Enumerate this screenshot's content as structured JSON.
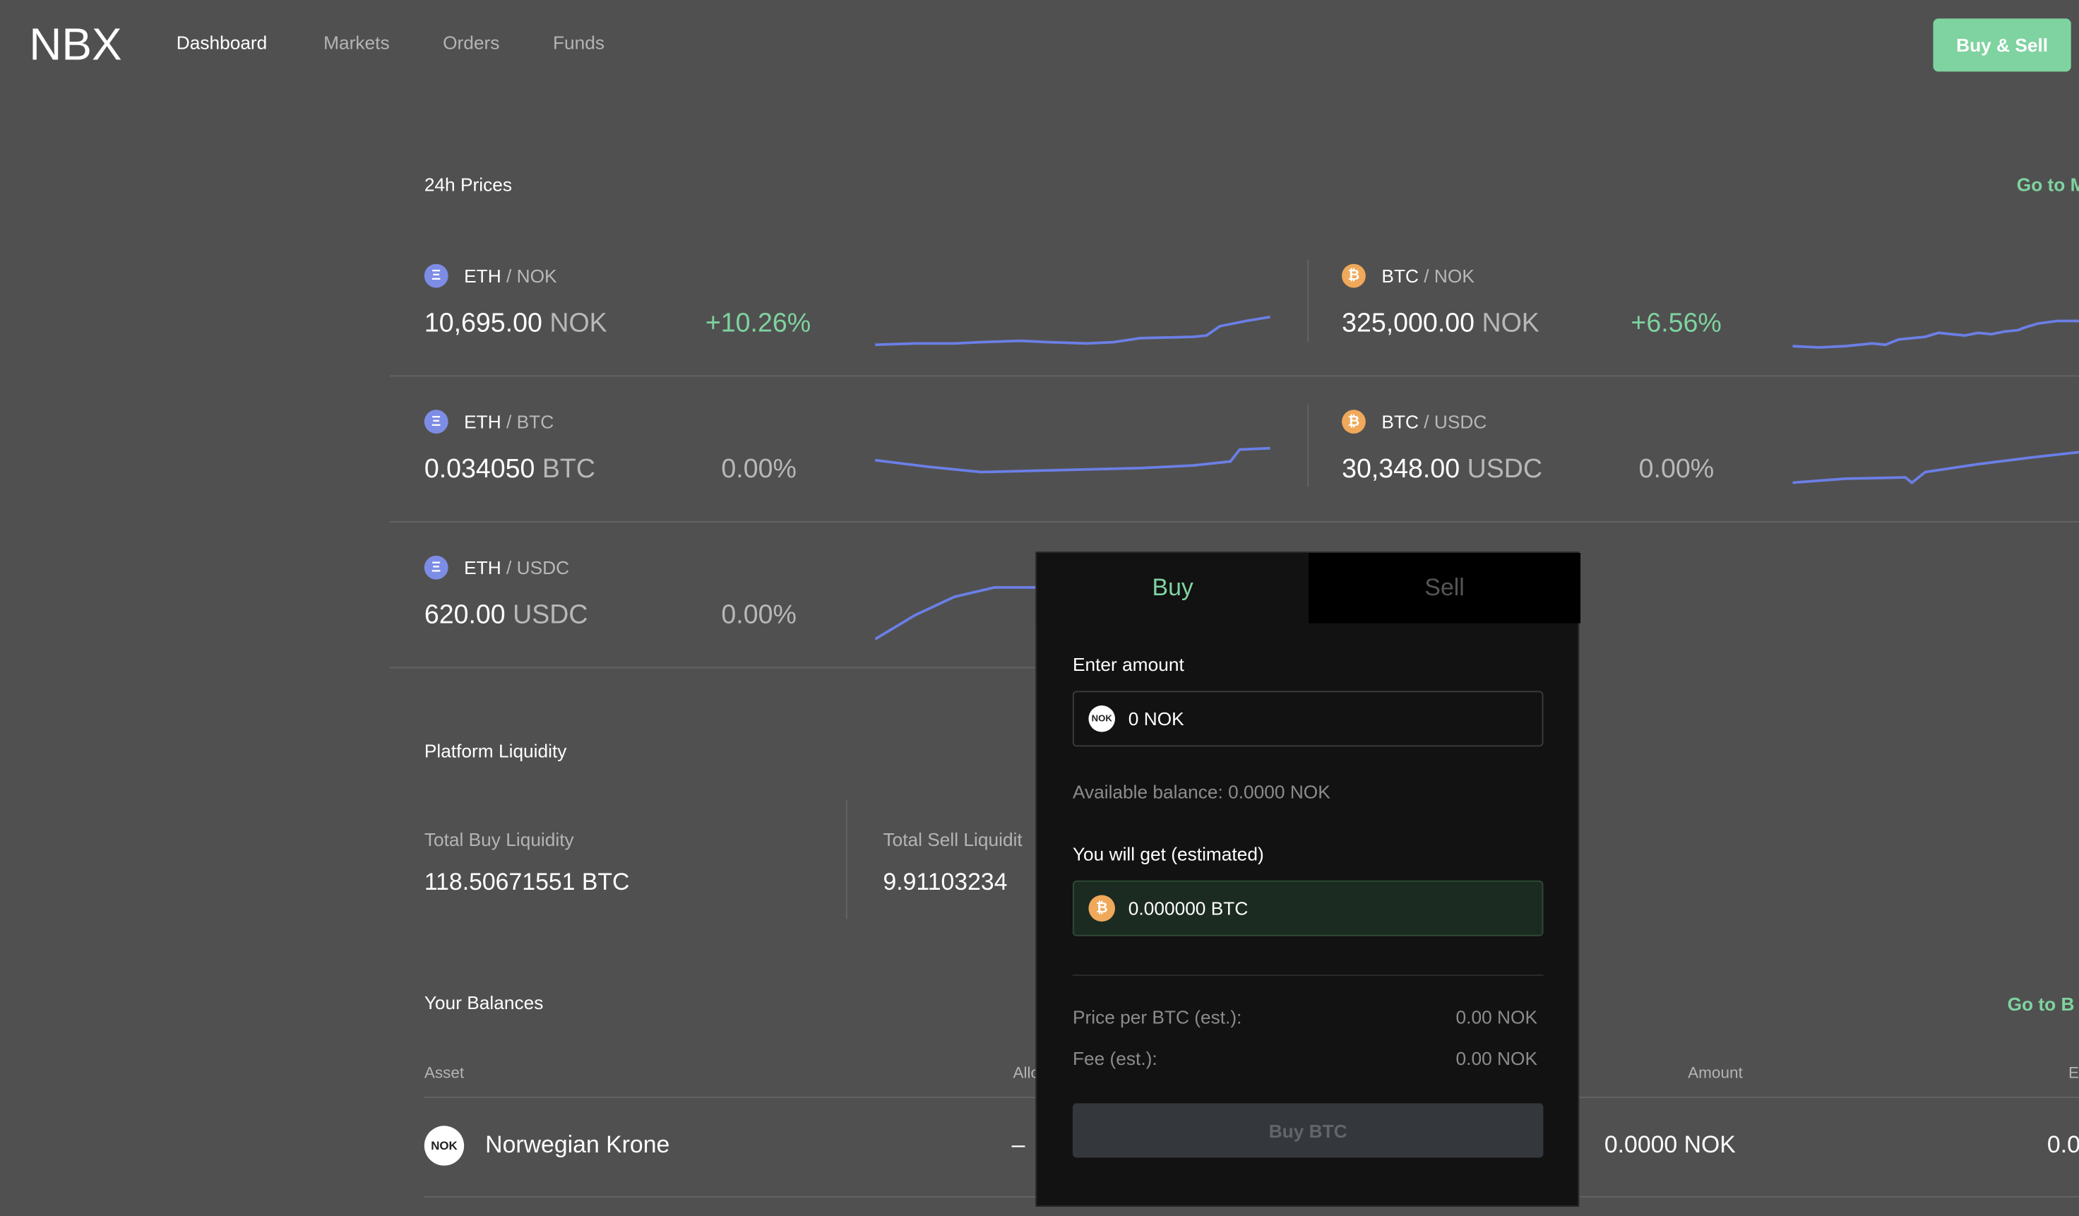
{
  "nav": {
    "logo": "NBX",
    "links": [
      "Dashboard",
      "Markets",
      "Orders",
      "Funds"
    ],
    "cta": "Buy & Sell"
  },
  "prices": {
    "title": "24h Prices",
    "go_link": "Go to M",
    "cards": [
      {
        "base": "ETH",
        "quote": "/ NOK",
        "price": "10,695.00",
        "unit": "NOK",
        "change": "+10.26%"
      },
      {
        "base": "BTC",
        "quote": "/ NOK",
        "price": "325,000.00",
        "unit": "NOK",
        "change": "+6.56%"
      },
      {
        "base": "ETH",
        "quote": "/ BTC",
        "price": "0.034050",
        "unit": "BTC",
        "change": "0.00%"
      },
      {
        "base": "BTC",
        "quote": "/ USDC",
        "price": "30,348.00",
        "unit": "USDC",
        "change": "0.00%"
      },
      {
        "base": "ETH",
        "quote": "/ USDC",
        "price": "620.00",
        "unit": "USDC",
        "change": "0.00%"
      }
    ]
  },
  "liquidity": {
    "title": "Platform Liquidity",
    "buy_label": "Total Buy Liquidity",
    "buy_value": "118.50671551 BTC",
    "sell_label": "Total Sell Liquidit",
    "sell_value": "9.91103234"
  },
  "balances": {
    "title": "Your Balances",
    "go_link": "Go to B",
    "columns": [
      "Asset",
      "Allo",
      "Amount",
      "E"
    ],
    "rows": [
      {
        "icon": "NOK",
        "asset": "Norwegian Krone",
        "allocation": "–",
        "amount": "0.0000 NOK",
        "estimate": "0.0"
      }
    ]
  },
  "trade_modal": {
    "tabs": [
      "Buy",
      "Sell"
    ],
    "enter_label": "Enter amount",
    "amount_icon": "NOK",
    "amount_value": "0 NOK",
    "available": "Available balance: 0.0000 NOK",
    "get_label": "You will get (estimated)",
    "get_value": "0.000000 BTC",
    "price_label": "Price per BTC (est.):",
    "price_value": "0.00 NOK",
    "fee_label": "Fee (est.):",
    "fee_value": "0.00 NOK",
    "button": "Buy BTC"
  },
  "icons": {
    "eth": "ethereum-icon",
    "btc": "bitcoin-icon"
  },
  "colors": {
    "background": "#505050",
    "accent": "#7fd3a0",
    "sparkline": "#6b7fe6",
    "modal_bg": "#121212"
  }
}
